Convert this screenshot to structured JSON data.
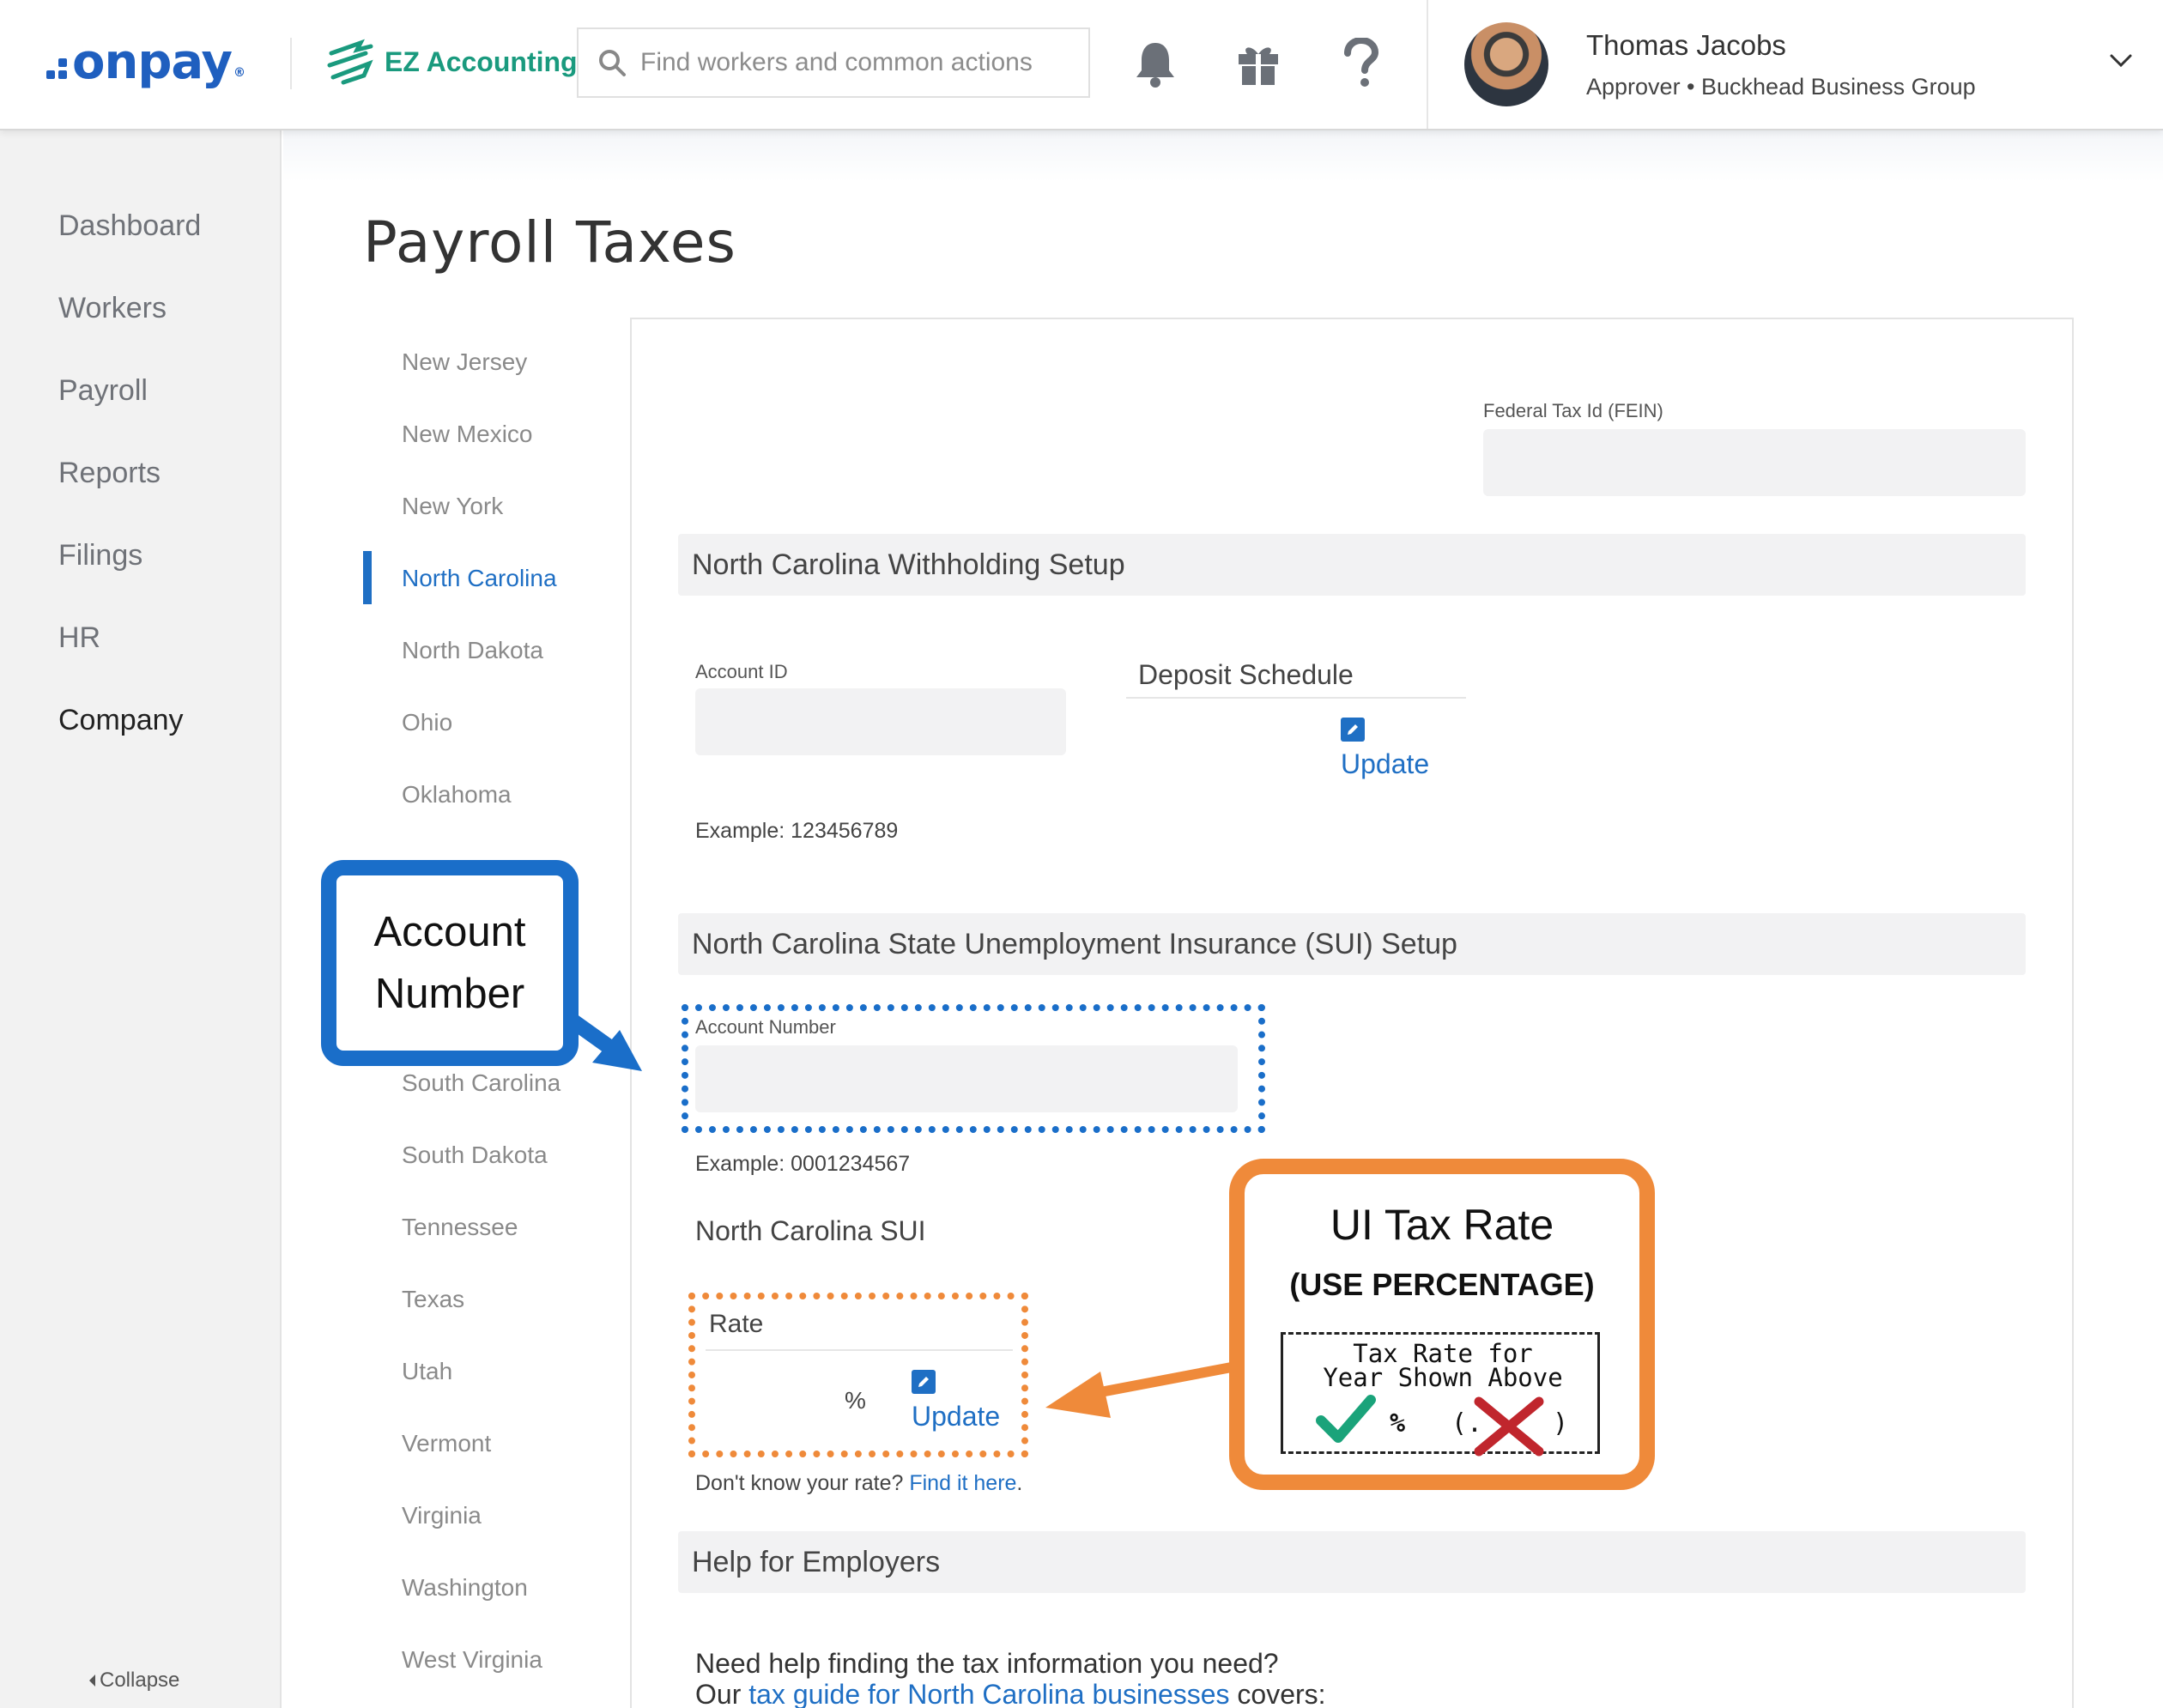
{
  "header": {
    "logo_text": "onpay",
    "logo_mark": "®",
    "integration_label": "EZ Accounting",
    "search_placeholder": "Find workers and common actions",
    "user": {
      "name": "Thomas Jacobs",
      "role": "Approver • Buckhead Business Group"
    }
  },
  "sidebar": {
    "items": [
      {
        "label": "Dashboard"
      },
      {
        "label": "Workers"
      },
      {
        "label": "Payroll"
      },
      {
        "label": "Reports"
      },
      {
        "label": "Filings"
      },
      {
        "label": "HR"
      },
      {
        "label": "Company"
      }
    ],
    "active": "Company",
    "collapse_label": "Collapse"
  },
  "page": {
    "title": "Payroll Taxes"
  },
  "states": {
    "items": [
      "New Jersey",
      "New Mexico",
      "New York",
      "North Carolina",
      "North Dakota",
      "Ohio",
      "Oklahoma",
      "South Carolina",
      "South Dakota",
      "Tennessee",
      "Texas",
      "Utah",
      "Vermont",
      "Virginia",
      "Washington",
      "West Virginia"
    ],
    "active": "North Carolina"
  },
  "fein": {
    "label": "Federal Tax Id (FEIN)"
  },
  "withholding": {
    "title": "North Carolina Withholding Setup",
    "account_label": "Account ID",
    "account_example": "Example: 123456789",
    "deposit_label": "Deposit Schedule",
    "update_label": "Update"
  },
  "sui": {
    "title": "North Carolina State Unemployment Insurance (SUI) Setup",
    "account_label": "Account Number",
    "account_example": "Example: 0001234567",
    "sub_title": "North Carolina SUI",
    "rate_label": "Rate",
    "rate_unit": "%",
    "update_label": "Update",
    "rate_help_text": "Don't know your rate?",
    "rate_help_link": "Find it here",
    "rate_help_end": "."
  },
  "help": {
    "title": "Help for Employers",
    "line1": "Need help finding the tax information you need?",
    "line2_prefix": "Our",
    "line2_link": "tax guide for North Carolina businesses",
    "line2_suffix": "covers:"
  },
  "annotations": {
    "account_callout_line1": "Account",
    "account_callout_line2": "Number",
    "rate_callout_title": "UI Tax Rate",
    "rate_callout_sub": "(USE PERCENTAGE)",
    "rate_callout_box_line1": "Tax Rate for",
    "rate_callout_box_line2": "Year Shown Above",
    "rate_callout_good": "%",
    "rate_callout_bad_open": "(.",
    "rate_callout_bad_close": ")",
    "colors": {
      "blue": "#1a6ec9",
      "orange": "#ef8a3a",
      "check": "#1aa37a",
      "cross": "#c0262d"
    }
  }
}
